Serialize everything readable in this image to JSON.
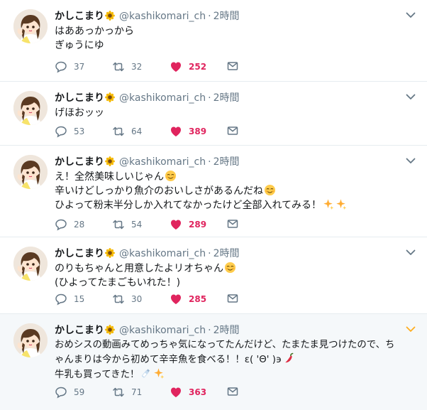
{
  "user": {
    "name": "かしこまり",
    "handle": "@kashikomari_ch"
  },
  "tweets": [
    {
      "time": "2時間",
      "lines": [
        "はああっかっから",
        "ぎゅうにゆ"
      ],
      "replies": "37",
      "retweets": "32",
      "likes": "252"
    },
    {
      "time": "2時間",
      "lines": [
        "げほおッッ"
      ],
      "replies": "53",
      "retweets": "64",
      "likes": "389"
    },
    {
      "time": "2時間",
      "lines": [
        "え！全然美味しいじゃん",
        "辛いけどしっかり魚介のおいしさがあるんだね",
        "ひよって粉末半分しか入れてなかったけど全部入れてみる！"
      ],
      "replies": "28",
      "retweets": "54",
      "likes": "289"
    },
    {
      "time": "2時間",
      "lines": [
        "のりもちゃんと用意したよリオちゃん",
        "(ひよってたまごもいれた！)"
      ],
      "replies": "15",
      "retweets": "30",
      "likes": "285"
    },
    {
      "time": "2時間",
      "lines": [
        "おめシスの動画みてめっちゃ気になってたんだけど、たまたま見つけたので、ち",
        "ゃんまりは今から初めて辛辛魚を食べる！！ε( 'Θ' )϶",
        "牛乳も買ってきた！"
      ],
      "replies": "59",
      "retweets": "71",
      "likes": "363"
    }
  ],
  "icons": {
    "name_emoji": "sunflower-emoji",
    "reply": "reply-icon",
    "retweet": "retweet-icon",
    "like": "heart-icon",
    "dm": "envelope-icon",
    "caret": "chevron-down-icon"
  },
  "colors": {
    "like": "#e0245e",
    "muted": "#657786",
    "caret_highlight": "#ffad1f"
  }
}
